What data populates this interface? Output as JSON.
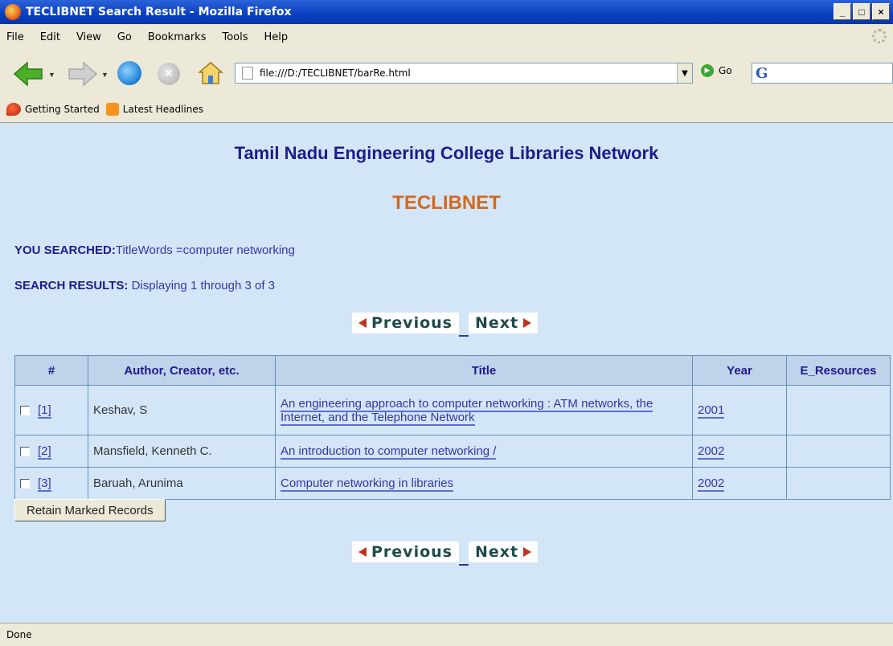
{
  "window": {
    "title": "TECLIBNET Search Result - Mozilla Firefox",
    "min": "_",
    "max": "□",
    "close": "×"
  },
  "menu": [
    "File",
    "Edit",
    "View",
    "Go",
    "Bookmarks",
    "Tools",
    "Help"
  ],
  "toolbar": {
    "url": "file:///D:/TECLIBNET/barRe.html",
    "go_label": "Go",
    "search_engine_glyph": "G"
  },
  "bookmarks": [
    "Getting Started",
    "Latest Headlines"
  ],
  "page": {
    "title": "Tamil Nadu Engineering College Libraries Network",
    "subtitle": "TECLIBNET",
    "searched_label": "YOU SEARCHED:",
    "searched_value": "TitleWords =computer networking",
    "results_label": "SEARCH RESULTS:",
    "results_value": " Displaying 1 through 3 of   3",
    "prev_label": "Previous",
    "next_label": "Next",
    "retain_label": "Retain Marked Records"
  },
  "table": {
    "headers": [
      "#",
      "Author, Creator, etc.",
      "Title",
      "Year",
      "E_Resources"
    ],
    "rows": [
      {
        "num": "[1]",
        "author": "Keshav, S",
        "title": "An engineering approach to computer networking : ATM networks, the Internet, and the Telephone Network",
        "year": "2001",
        "eres": ""
      },
      {
        "num": "[2]",
        "author": "Mansfield, Kenneth C.",
        "title": "An introduction to computer networking /",
        "year": "2002",
        "eres": ""
      },
      {
        "num": "[3]",
        "author": "Baruah, Arunima",
        "title": "Computer networking in libraries",
        "year": "2002",
        "eres": ""
      }
    ]
  },
  "status": "Done",
  "icons": [
    "firefox-logo-icon",
    "back-arrow-icon",
    "forward-arrow-icon",
    "reload-icon",
    "stop-icon",
    "home-icon",
    "page-icon",
    "go-icon",
    "google-icon",
    "bookmark-icon",
    "rss-icon",
    "throbber-icon"
  ]
}
